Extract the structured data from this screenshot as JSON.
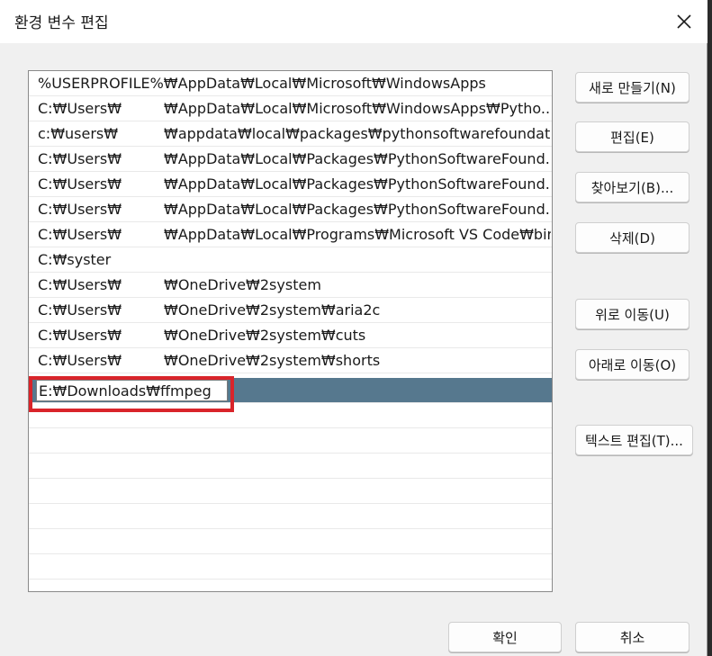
{
  "dialog": {
    "title": "환경 변수 편집",
    "close_icon": "close-icon"
  },
  "paths": [
    {
      "full": "%USERPROFILE%₩AppData₩Local₩Microsoft₩WindowsApps"
    },
    {
      "a": "C:₩Users₩",
      "b": "₩AppData₩Local₩Microsoft₩WindowsApps₩Pytho..."
    },
    {
      "a": "c:₩users₩",
      "b": "₩appdata₩local₩packages₩pythonsoftwarefoundati..."
    },
    {
      "a": "C:₩Users₩",
      "b": "₩AppData₩Local₩Packages₩PythonSoftwareFound..."
    },
    {
      "a": "C:₩Users₩",
      "b": "₩AppData₩Local₩Packages₩PythonSoftwareFound..."
    },
    {
      "a": "C:₩Users₩",
      "b": "₩AppData₩Local₩Packages₩PythonSoftwareFound..."
    },
    {
      "a": "C:₩Users₩",
      "b": "₩AppData₩Local₩Programs₩Microsoft VS Code₩bin"
    },
    {
      "a": "C:₩syster",
      "b": ""
    },
    {
      "a": "C:₩Users₩",
      "b": "₩OneDrive₩2system"
    },
    {
      "a": "C:₩Users₩",
      "b": "₩OneDrive₩2system₩aria2c"
    },
    {
      "a": "C:₩Users₩",
      "b": "₩OneDrive₩2system₩cuts"
    },
    {
      "a": "C:₩Users₩",
      "b": "₩OneDrive₩2system₩shorts"
    }
  ],
  "editing_row": {
    "value": "E:₩Downloads₩ffmpeg"
  },
  "buttons": {
    "new": "새로 만들기(N)",
    "edit": "편집(E)",
    "browse": "찾아보기(B)...",
    "delete": "삭제(D)",
    "move_up": "위로 이동(U)",
    "move_down": "아래로 이동(O)",
    "edit_text": "텍스트 편집(T)...",
    "ok": "확인",
    "cancel": "취소"
  },
  "colors": {
    "selected_row": "#56788e",
    "highlight_border": "#d9242a"
  }
}
